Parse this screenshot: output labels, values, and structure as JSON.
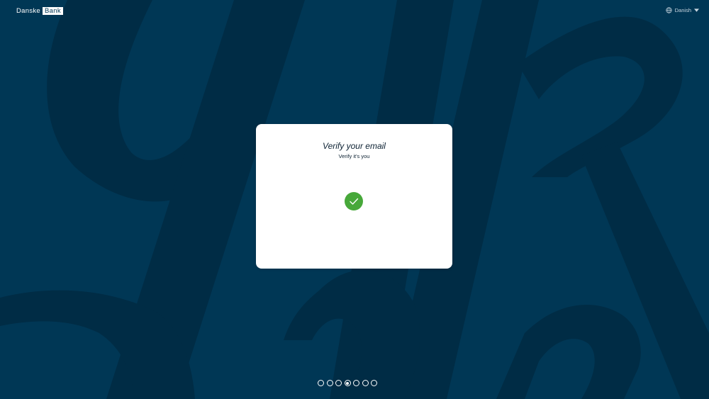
{
  "brand": {
    "name": "Danske",
    "name_boxed": "Bank"
  },
  "language": {
    "label": "Danish",
    "icon": "globe-icon",
    "caret_icon": "caret-down-icon"
  },
  "card": {
    "title": "Verify your email",
    "subtitle": "Verify it's you",
    "status_icon": "check-circle-icon",
    "status_color": "#47a83a"
  },
  "progress": {
    "total_steps": 7,
    "current_step": 4
  },
  "colors": {
    "background": "#003755",
    "background_letters": "#002c45",
    "card": "#ffffff",
    "success": "#47a83a"
  }
}
